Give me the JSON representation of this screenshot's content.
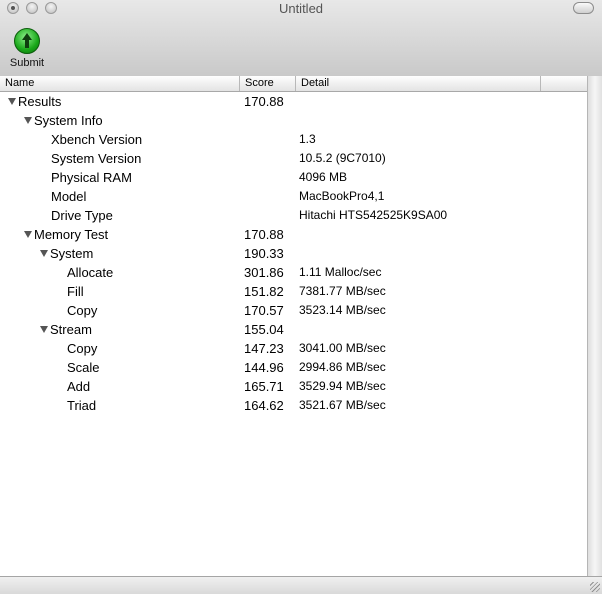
{
  "window": {
    "title": "Untitled"
  },
  "toolbar": {
    "submit_label": "Submit"
  },
  "columns": {
    "name": "Name",
    "score": "Score",
    "detail": "Detail",
    "extra": ""
  },
  "rows": [
    {
      "name": "Results",
      "score": "170.88",
      "detail": ""
    },
    {
      "name": "System Info",
      "score": "",
      "detail": ""
    },
    {
      "name": "Xbench Version",
      "score": "",
      "detail": "1.3"
    },
    {
      "name": "System Version",
      "score": "",
      "detail": "10.5.2 (9C7010)"
    },
    {
      "name": "Physical RAM",
      "score": "",
      "detail": "4096 MB"
    },
    {
      "name": "Model",
      "score": "",
      "detail": "MacBookPro4,1"
    },
    {
      "name": "Drive Type",
      "score": "",
      "detail": "Hitachi HTS542525K9SA00"
    },
    {
      "name": "Memory Test",
      "score": "170.88",
      "detail": ""
    },
    {
      "name": "System",
      "score": "190.33",
      "detail": ""
    },
    {
      "name": "Allocate",
      "score": "301.86",
      "detail": "1.11 Malloc/sec"
    },
    {
      "name": "Fill",
      "score": "151.82",
      "detail": "7381.77 MB/sec"
    },
    {
      "name": "Copy",
      "score": "170.57",
      "detail": "3523.14 MB/sec"
    },
    {
      "name": "Stream",
      "score": "155.04",
      "detail": ""
    },
    {
      "name": "Copy",
      "score": "147.23",
      "detail": "3041.00 MB/sec"
    },
    {
      "name": "Scale",
      "score": "144.96",
      "detail": "2994.86 MB/sec"
    },
    {
      "name": "Add",
      "score": "165.71",
      "detail": "3529.94 MB/sec"
    },
    {
      "name": "Triad",
      "score": "164.62",
      "detail": "3521.67 MB/sec"
    }
  ]
}
